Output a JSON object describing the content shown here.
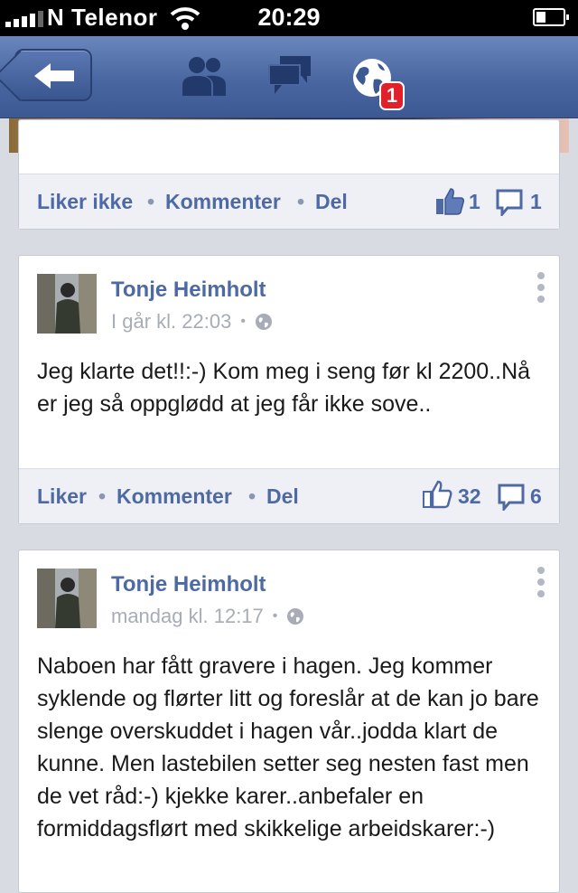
{
  "status_bar": {
    "carrier": "N Telenor",
    "time": "20:29"
  },
  "nav": {
    "notification_count": "1"
  },
  "colors": {
    "nav_blue": "#4a66a0",
    "link_blue": "#4e6aa4",
    "badge_red": "#e0202a"
  },
  "cards": [
    {
      "actions": {
        "like": "Liker ikke",
        "comment": "Kommenter",
        "share": "Del",
        "likes": "1",
        "comments": "1"
      }
    },
    {
      "author": "Tonje Heimholt",
      "meta": "I går kl. 22:03",
      "text": "Jeg klarte det!!:-) Kom meg i seng før kl 2200..Nå er jeg så oppglødd at jeg får ikke sove..",
      "actions": {
        "like": "Liker",
        "comment": "Kommenter",
        "share": "Del",
        "likes": "32",
        "comments": "6"
      }
    },
    {
      "author": "Tonje Heimholt",
      "meta": "mandag kl. 12:17",
      "text": "Naboen har fått gravere i hagen. Jeg kommer syklende og flørter litt og foreslår at de kan jo bare slenge overskuddet i hagen vår..jodda klart de kunne. Men lastebilen setter seg nesten fast men de vet råd:-) kjekke karer..anbefaler en formiddagsflørt med skikkelige arbeidskarer:-)"
    }
  ]
}
